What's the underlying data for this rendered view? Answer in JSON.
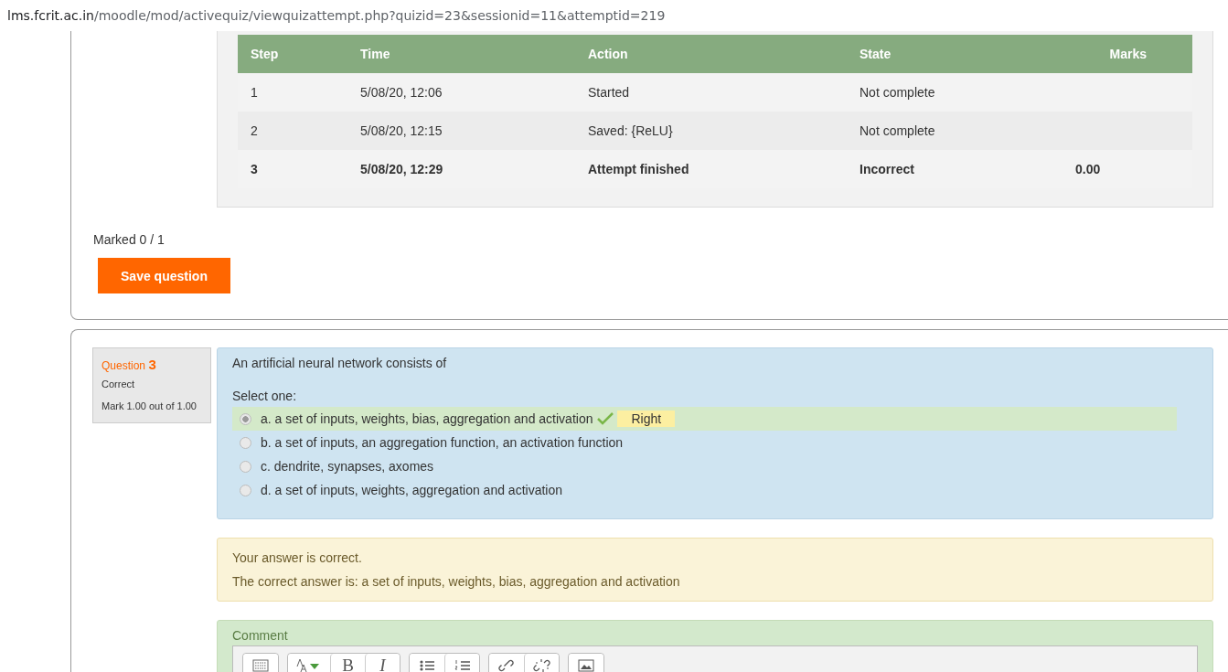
{
  "address_bar": {
    "host": "lms.fcrit.ac.in",
    "path": "/moodle/mod/activequiz/viewquizattempt.php?quizid=23&sessionid=11&attemptid=219"
  },
  "history": {
    "columns": [
      "Step",
      "Time",
      "Action",
      "State",
      "Marks"
    ],
    "rows": [
      {
        "cells": [
          "1",
          "5/08/20, 12:06",
          "Started",
          "Not complete",
          ""
        ],
        "current": false
      },
      {
        "cells": [
          "2",
          "5/08/20, 12:15",
          "Saved: {ReLU}",
          "Not complete",
          ""
        ],
        "current": false
      },
      {
        "cells": [
          "3",
          "5/08/20, 12:29",
          "Attempt finished",
          "Incorrect",
          "0.00"
        ],
        "current": true
      }
    ]
  },
  "marked": "Marked 0 / 1",
  "save_button": "Save question",
  "question": {
    "label": "Question",
    "number": "3",
    "status": "Correct",
    "mark": "Mark 1.00 out of 1.00",
    "text": "An artificial neural network consists of",
    "prompt": "Select one:",
    "options": [
      {
        "text": "a. a set of inputs, weights, bias, aggregation and activation",
        "selected": true,
        "correct": true,
        "badge": "Right"
      },
      {
        "text": "b. a set of inputs, an aggregation function, an activation function",
        "selected": false,
        "correct": false
      },
      {
        "text": "c. dendrite, synapses, axomes",
        "selected": false,
        "correct": false
      },
      {
        "text": "d. a set of inputs, weights, aggregation and activation",
        "selected": false,
        "correct": false
      }
    ],
    "feedback": [
      "Your answer is correct.",
      "The correct answer is: a set of inputs, weights, bias, aggregation and activation"
    ],
    "comment_label": "Comment",
    "toolbar": [
      [
        {
          "kind": "keyboard"
        }
      ],
      [
        {
          "kind": "font"
        },
        {
          "kind": "bold",
          "label": "B"
        },
        {
          "kind": "italic",
          "label": "I"
        }
      ],
      [
        {
          "kind": "bullets"
        },
        {
          "kind": "numbers"
        }
      ],
      [
        {
          "kind": "link"
        },
        {
          "kind": "unlink"
        }
      ],
      [
        {
          "kind": "image"
        }
      ]
    ]
  }
}
